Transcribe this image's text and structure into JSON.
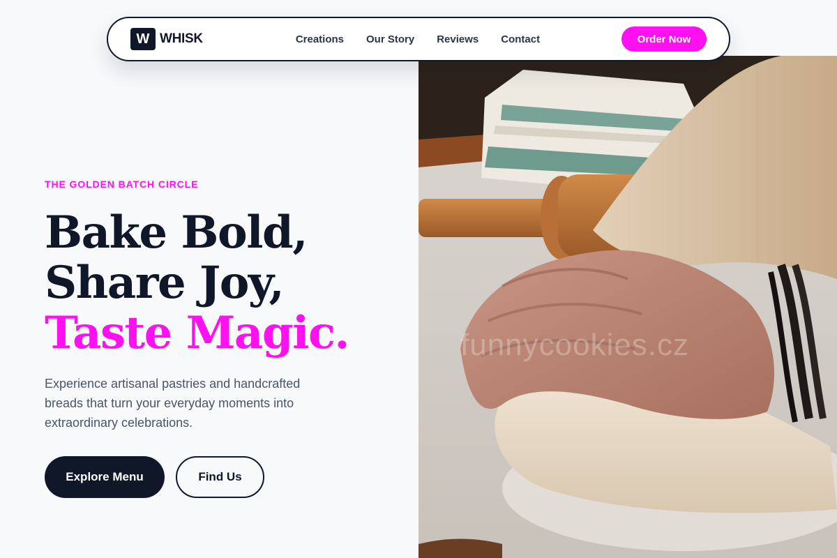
{
  "brand": {
    "logo_letter": "W",
    "name": "WHISK"
  },
  "nav": {
    "links": [
      {
        "label": "Creations"
      },
      {
        "label": "Our Story"
      },
      {
        "label": "Reviews"
      },
      {
        "label": "Contact"
      }
    ],
    "cta_label": "Order Now"
  },
  "hero": {
    "eyebrow": "THE GOLDEN BATCH CIRCLE",
    "headline_line1": "Bake Bold,",
    "headline_line2": "Share Joy,",
    "headline_line3": "Taste Magic.",
    "description": "Experience artisanal pastries and handcrafted breads that turn your everyday moments into extraordinary celebrations.",
    "primary_cta": "Explore Menu",
    "secondary_cta": "Find Us",
    "image_watermark": "funnycookies.cz"
  },
  "colors": {
    "accent": "#ff10f0",
    "dark": "#0f1729",
    "background": "#f8f9fb",
    "body_text": "#4a5568"
  },
  "icons": {
    "hero_image": "baker-kneading-dough-photo"
  }
}
